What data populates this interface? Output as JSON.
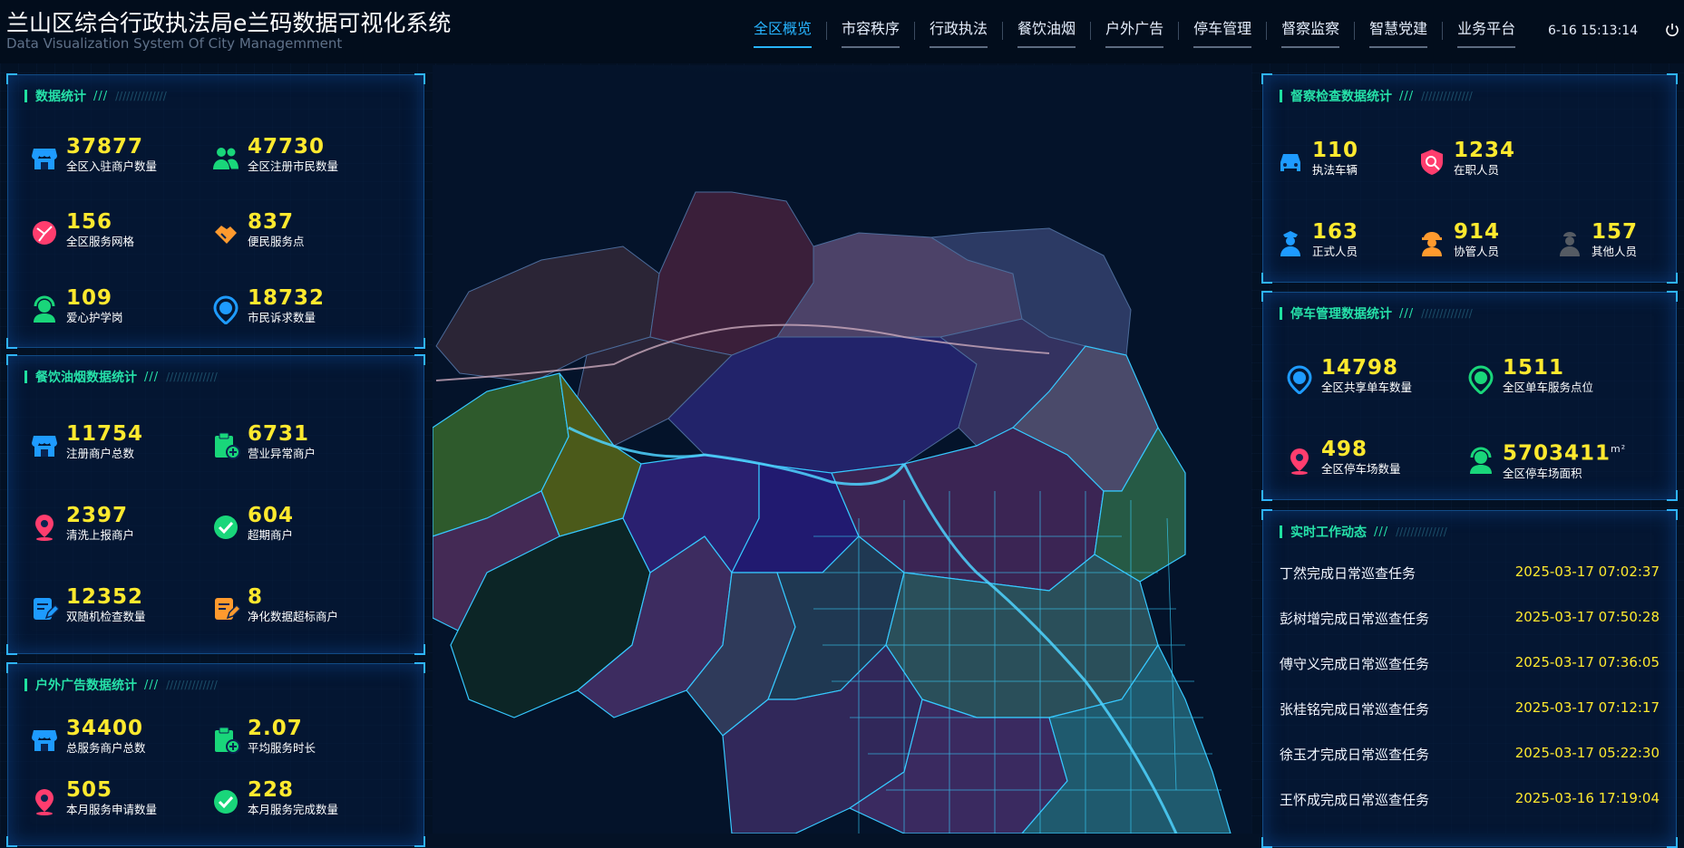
{
  "header": {
    "title": "兰山区综合行政执法局e兰码数据可视化系统",
    "subtitle": "Data Visualization System Of City Managemment",
    "clock": "6-16 15:13:14"
  },
  "nav": [
    {
      "label": "全区概览",
      "active": true
    },
    {
      "label": "市容秩序"
    },
    {
      "label": "行政执法"
    },
    {
      "label": "餐饮油烟"
    },
    {
      "label": "户外广告"
    },
    {
      "label": "停车管理"
    },
    {
      "label": "督察监察"
    },
    {
      "label": "智慧党建"
    },
    {
      "label": "业务平台"
    }
  ],
  "panels": {
    "data_stats": {
      "title": "数据统计",
      "items": [
        {
          "value": "37877",
          "label": "全区入驻商户数量",
          "icon": "shop-icon"
        },
        {
          "value": "47730",
          "label": "全区注册市民数量",
          "icon": "people-icon"
        },
        {
          "value": "156",
          "label": "全区服务网格",
          "icon": "grid-location-icon"
        },
        {
          "value": "837",
          "label": "便民服务点",
          "icon": "handshake-icon"
        },
        {
          "value": "109",
          "label": "爱心护学岗",
          "icon": "service-agent-icon"
        },
        {
          "value": "18732",
          "label": "市民诉求数量",
          "icon": "bike-pin-icon"
        }
      ]
    },
    "catering": {
      "title": "餐饮油烟数据统计",
      "items": [
        {
          "value": "11754",
          "label": "注册商户总数",
          "icon": "shop-icon"
        },
        {
          "value": "6731",
          "label": "营业异常商户",
          "icon": "clipboard-add-icon"
        },
        {
          "value": "2397",
          "label": "清洗上报商户",
          "icon": "location-pin-icon"
        },
        {
          "value": "604",
          "label": "超期商户",
          "icon": "check-circle-icon"
        },
        {
          "value": "12352",
          "label": "双随机检查数量",
          "icon": "edit-doc-icon"
        },
        {
          "value": "8",
          "label": "净化数据超标商户",
          "icon": "edit-doc-icon"
        }
      ]
    },
    "outdoor_ads": {
      "title": "户外广告数据统计",
      "items": [
        {
          "value": "34400",
          "label": "总服务商户总数",
          "icon": "shop-icon"
        },
        {
          "value": "2.07",
          "label": "平均服务时长",
          "icon": "clipboard-add-icon"
        },
        {
          "value": "505",
          "label": "本月服务申请数量",
          "icon": "location-pin-icon"
        },
        {
          "value": "228",
          "label": "本月服务完成数量",
          "icon": "check-circle-icon"
        }
      ]
    },
    "inspection": {
      "title": "督察检查数据统计",
      "items": [
        {
          "value": "110",
          "label": "执法车辆",
          "icon": "car-icon"
        },
        {
          "value": "1234",
          "label": "在职人员",
          "icon": "shield-search-icon"
        },
        {
          "value": "163",
          "label": "正式人员",
          "icon": "officer-icon"
        },
        {
          "value": "914",
          "label": "协管人员",
          "icon": "worker-icon"
        },
        {
          "value": "157",
          "label": "其他人员",
          "icon": "person-icon"
        }
      ]
    },
    "parking": {
      "title": "停车管理数据统计",
      "unit": "m²",
      "items": [
        {
          "value": "14798",
          "label": "全区共享单车数量",
          "icon": "bike-pin-icon"
        },
        {
          "value": "1511",
          "label": "全区单车服务点位",
          "icon": "bike-pin-icon"
        },
        {
          "value": "498",
          "label": "全区停车场数量",
          "icon": "location-pin-icon"
        },
        {
          "value": "5703411",
          "label": "全区停车场面积",
          "icon": "service-agent-icon"
        }
      ]
    },
    "realtime": {
      "title": "实时工作动态",
      "items": [
        {
          "who": "丁然完成日常巡查任务",
          "time": "2025-03-17 07:02:37"
        },
        {
          "who": "彭树增完成日常巡查任务",
          "time": "2025-03-17 07:50:28"
        },
        {
          "who": "傅守义完成日常巡查任务",
          "time": "2025-03-17 07:36:05"
        },
        {
          "who": "张桂铭完成日常巡查任务",
          "time": "2025-03-17 07:12:17"
        },
        {
          "who": "徐玉才完成日常巡查任务",
          "time": "2025-03-17 05:22:30"
        },
        {
          "who": "王怀成完成日常巡查任务",
          "time": "2025-03-16 17:19:04"
        }
      ]
    }
  },
  "colors": {
    "accent": "#27b4ff",
    "value": "#ffe92e",
    "title_green": "#26e2a9",
    "icon_blue": "#1e9bff",
    "icon_green": "#19d67a",
    "icon_pink": "#ff3d6e",
    "icon_orange": "#ff9a2e"
  }
}
